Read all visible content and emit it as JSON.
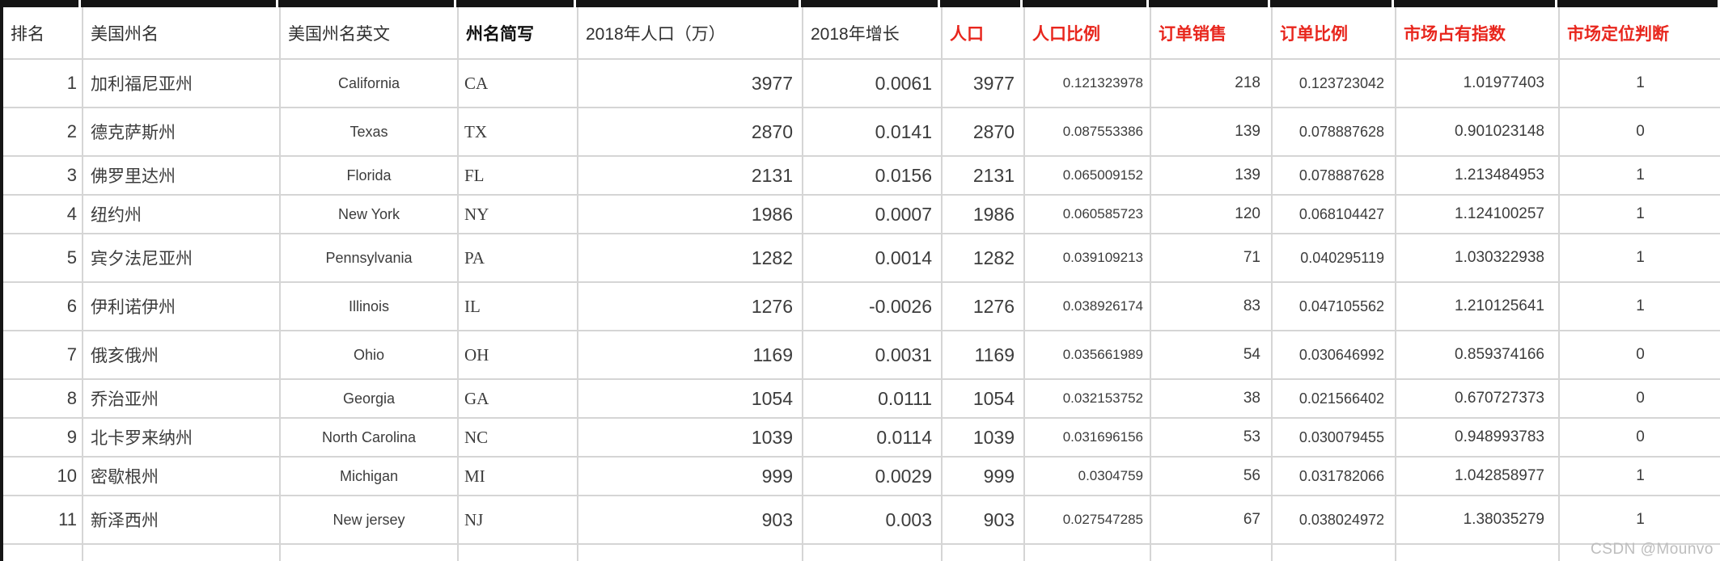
{
  "colors": {
    "accent_red": "#e8261d",
    "gridline": "#d5d5d5",
    "body_text": "#3c3c3c"
  },
  "watermark": "CSDN @Mounvo",
  "table": {
    "columns": [
      {
        "key": "rank",
        "label": "排名",
        "highlight": false,
        "bold": false
      },
      {
        "key": "state_cn",
        "label": "美国州名",
        "highlight": false,
        "bold": false
      },
      {
        "key": "state_en",
        "label": "美国州名英文",
        "highlight": false,
        "bold": false
      },
      {
        "key": "abbr",
        "label": "州名简写",
        "highlight": false,
        "bold": true
      },
      {
        "key": "pop2018",
        "label": "2018年人口（万）",
        "highlight": false,
        "bold": false
      },
      {
        "key": "growth2018",
        "label": "2018年增长",
        "highlight": false,
        "bold": false
      },
      {
        "key": "population",
        "label": "人口",
        "highlight": true,
        "bold": true
      },
      {
        "key": "pop_ratio",
        "label": "人口比例",
        "highlight": true,
        "bold": true
      },
      {
        "key": "order_sales",
        "label": "订单销售",
        "highlight": true,
        "bold": true
      },
      {
        "key": "order_ratio",
        "label": "订单比例",
        "highlight": true,
        "bold": true
      },
      {
        "key": "market_index",
        "label": "市场占有指数",
        "highlight": true,
        "bold": true
      },
      {
        "key": "market_judgment",
        "label": "市场定位判断",
        "highlight": true,
        "bold": true
      }
    ],
    "rows": [
      [
        "1",
        "加利福尼亚州",
        "California",
        "CA",
        "3977",
        "0.0061",
        "3977",
        "0.121323978",
        "218",
        "0.123723042",
        "1.01977403",
        "1"
      ],
      [
        "2",
        "德克萨斯州",
        "Texas",
        "TX",
        "2870",
        "0.0141",
        "2870",
        "0.087553386",
        "139",
        "0.078887628",
        "0.901023148",
        "0"
      ],
      [
        "3",
        "佛罗里达州",
        "Florida",
        "FL",
        "2131",
        "0.0156",
        "2131",
        "0.065009152",
        "139",
        "0.078887628",
        "1.213484953",
        "1"
      ],
      [
        "4",
        "纽约州",
        "New York",
        "NY",
        "1986",
        "0.0007",
        "1986",
        "0.060585723",
        "120",
        "0.068104427",
        "1.124100257",
        "1"
      ],
      [
        "5",
        "宾夕法尼亚州",
        "Pennsylvania",
        "PA",
        "1282",
        "0.0014",
        "1282",
        "0.039109213",
        "71",
        "0.040295119",
        "1.030322938",
        "1"
      ],
      [
        "6",
        "伊利诺伊州",
        "Illinois",
        "IL",
        "1276",
        "-0.0026",
        "1276",
        "0.038926174",
        "83",
        "0.047105562",
        "1.210125641",
        "1"
      ],
      [
        "7",
        "俄亥俄州",
        "Ohio",
        "OH",
        "1169",
        "0.0031",
        "1169",
        "0.035661989",
        "54",
        "0.030646992",
        "0.859374166",
        "0"
      ],
      [
        "8",
        "乔治亚州",
        "Georgia",
        "GA",
        "1054",
        "0.0111",
        "1054",
        "0.032153752",
        "38",
        "0.021566402",
        "0.670727373",
        "0"
      ],
      [
        "9",
        "北卡罗来纳州",
        "North Carolina",
        "NC",
        "1039",
        "0.0114",
        "1039",
        "0.031696156",
        "53",
        "0.030079455",
        "0.948993783",
        "0"
      ],
      [
        "10",
        "密歇根州",
        "Michigan",
        "MI",
        "999",
        "0.0029",
        "999",
        "0.0304759",
        "56",
        "0.031782066",
        "1.042858977",
        "1"
      ],
      [
        "11",
        "新泽西州",
        "New jersey",
        "NJ",
        "903",
        "0.003",
        "903",
        "0.027547285",
        "67",
        "0.038024972",
        "1.38035279",
        "1"
      ]
    ]
  }
}
